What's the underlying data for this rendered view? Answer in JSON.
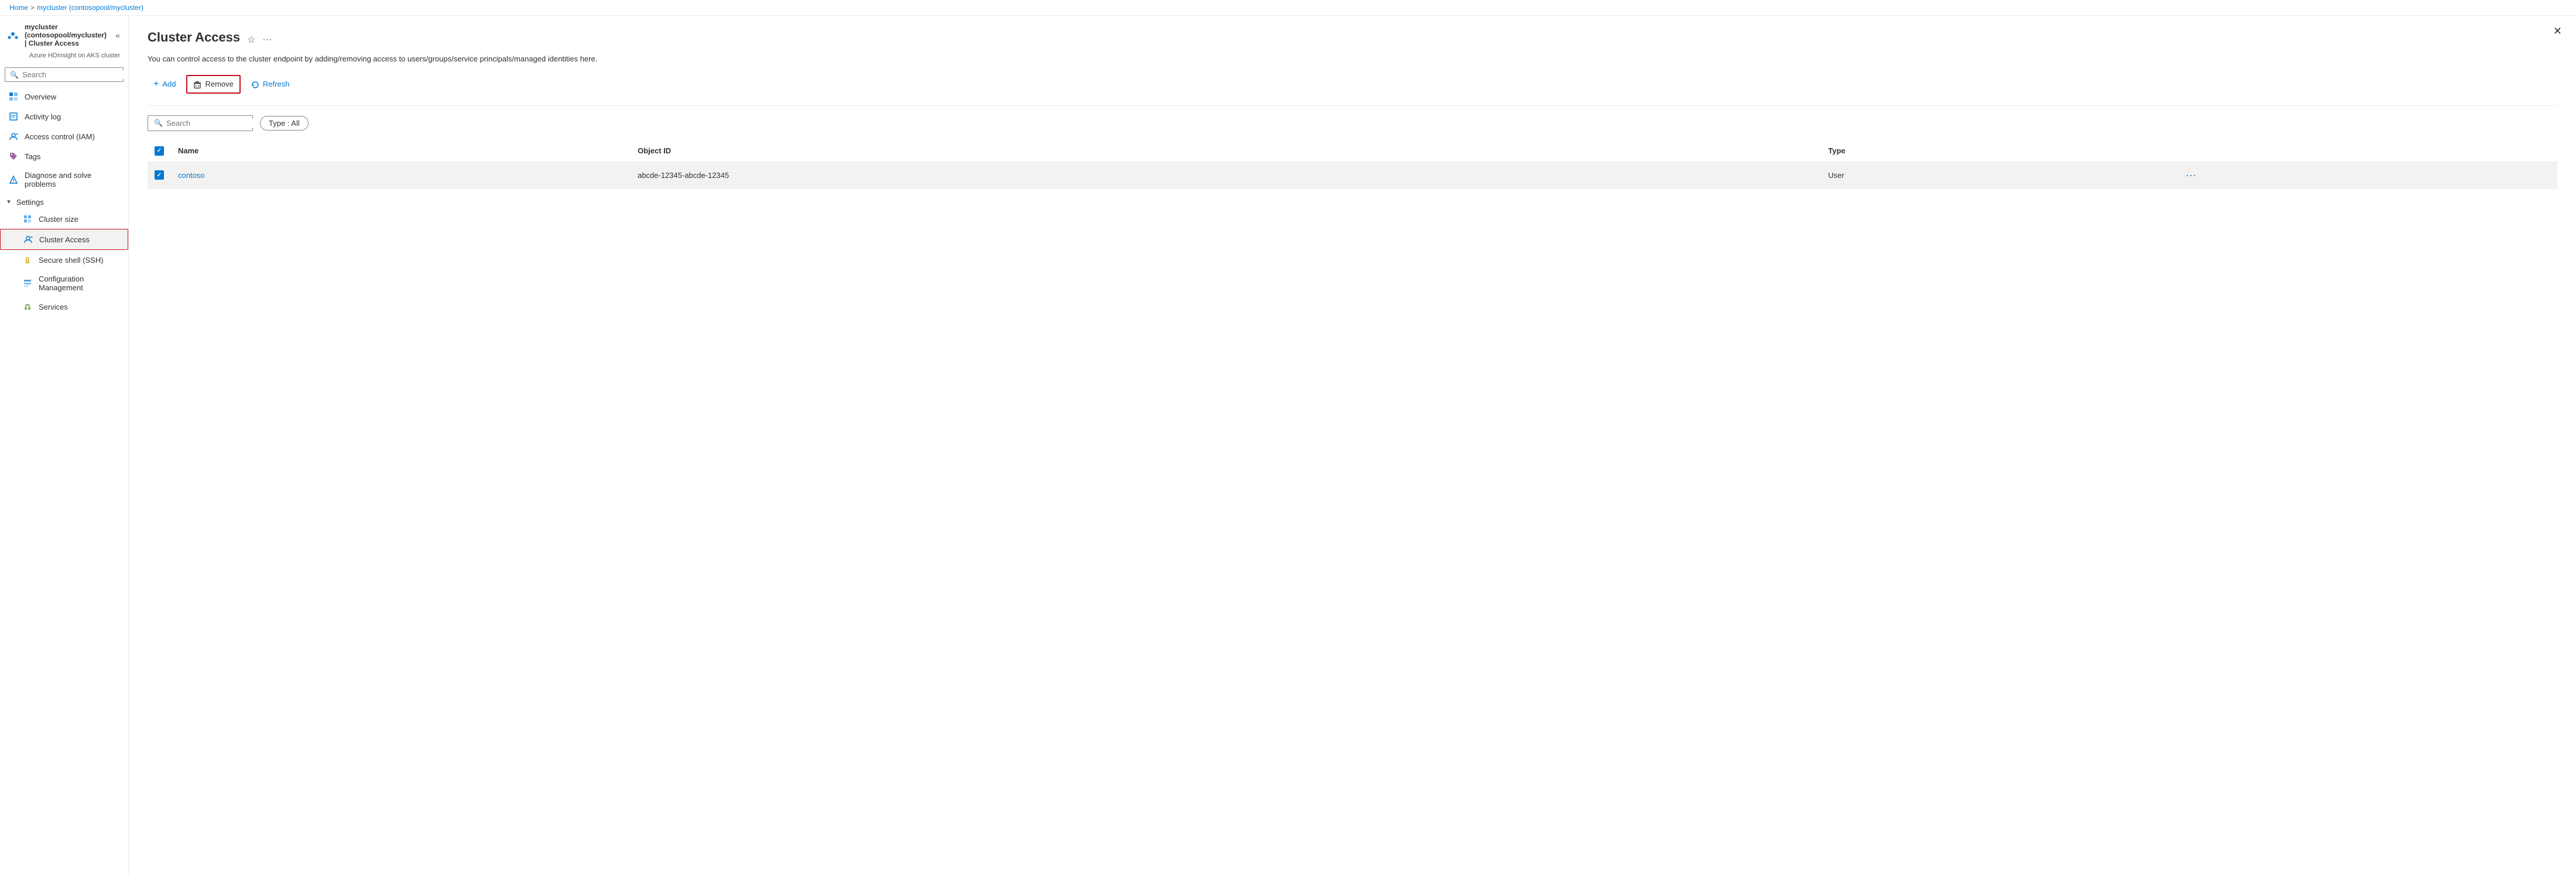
{
  "breadcrumb": {
    "home": "Home",
    "separator1": ">",
    "cluster": "mycluster (contosopool/mycluster)"
  },
  "header": {
    "title": "mycluster (contosopool/mycluster) | Cluster Access",
    "subtitle": "Azure HDInsight on AKS cluster"
  },
  "sidebar": {
    "search_placeholder": "Search",
    "nav_items": [
      {
        "id": "overview",
        "label": "Overview",
        "icon": "overview-icon"
      },
      {
        "id": "activity-log",
        "label": "Activity log",
        "icon": "activity-icon"
      },
      {
        "id": "access-control",
        "label": "Access control (IAM)",
        "icon": "iam-icon"
      },
      {
        "id": "tags",
        "label": "Tags",
        "icon": "tags-icon"
      },
      {
        "id": "diagnose",
        "label": "Diagnose and solve problems",
        "icon": "diagnose-icon"
      }
    ],
    "settings_label": "Settings",
    "settings_items": [
      {
        "id": "cluster-size",
        "label": "Cluster size",
        "icon": "clustersize-icon"
      },
      {
        "id": "cluster-access",
        "label": "Cluster Access",
        "icon": "clusteraccess-icon",
        "active": true
      },
      {
        "id": "secure-shell",
        "label": "Secure shell (SSH)",
        "icon": "ssh-icon"
      },
      {
        "id": "config-mgmt",
        "label": "Configuration Management",
        "icon": "config-icon"
      },
      {
        "id": "services",
        "label": "Services",
        "icon": "services-icon"
      }
    ]
  },
  "page": {
    "title": "Cluster Access",
    "description": "You can control access to the cluster endpoint by adding/removing access to users/groups/service principals/managed identities here."
  },
  "toolbar": {
    "add_label": "Add",
    "remove_label": "Remove",
    "refresh_label": "Refresh"
  },
  "filter": {
    "search_placeholder": "Search",
    "type_filter_label": "Type : All"
  },
  "table": {
    "columns": [
      {
        "id": "name",
        "label": "Name"
      },
      {
        "id": "object-id",
        "label": "Object ID"
      },
      {
        "id": "type",
        "label": "Type"
      }
    ],
    "rows": [
      {
        "id": "row-1",
        "selected": true,
        "name": "contoso",
        "object_id": "abcde-12345-abcde-12345",
        "type": "User"
      }
    ]
  }
}
